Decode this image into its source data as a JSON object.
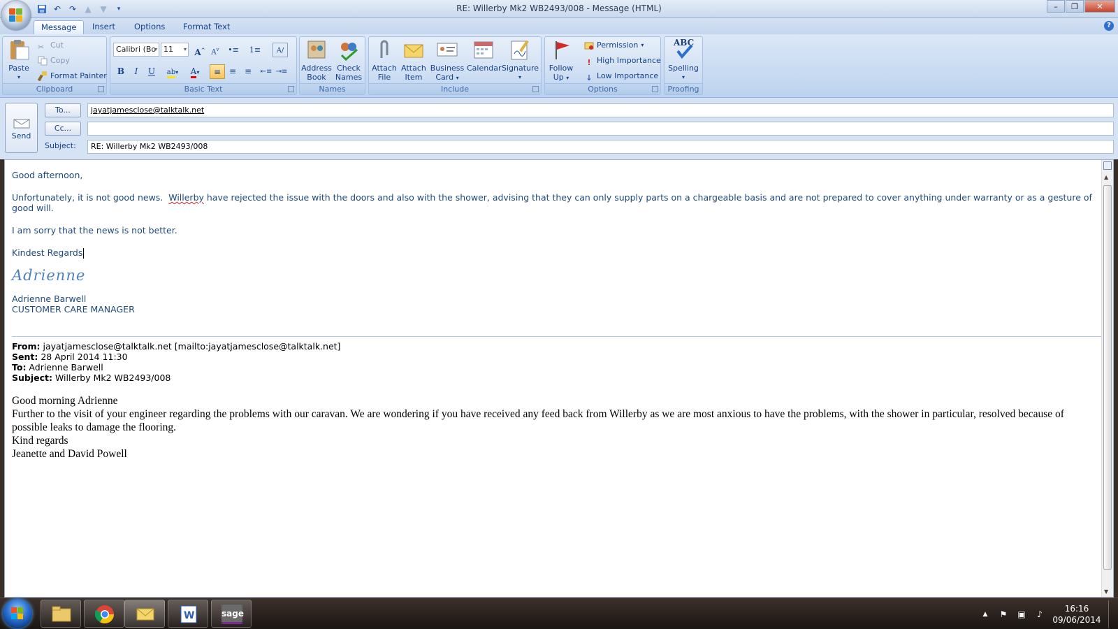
{
  "window": {
    "title": "RE: Willerby Mk2 WB2493/008  - Message (HTML)"
  },
  "tabs": [
    "Message",
    "Insert",
    "Options",
    "Format Text"
  ],
  "ribbon": {
    "clipboard": {
      "label": "Clipboard",
      "paste": "Paste",
      "cut": "Cut",
      "copy": "Copy",
      "format_painter": "Format Painter"
    },
    "basic_text": {
      "label": "Basic Text",
      "font_name": "Calibri (Bo",
      "font_size": "11",
      "bold": "B",
      "italic": "I",
      "underline": "U"
    },
    "names": {
      "label": "Names",
      "address_book": [
        "Address",
        "Book"
      ],
      "check_names": [
        "Check",
        "Names"
      ]
    },
    "include": {
      "label": "Include",
      "attach_file": [
        "Attach",
        "File"
      ],
      "attach_item": [
        "Attach",
        "Item"
      ],
      "business_card": [
        "Business",
        "Card"
      ],
      "calendar": "Calendar",
      "signature": "Signature"
    },
    "options": {
      "label": "Options",
      "follow_up": [
        "Follow",
        "Up"
      ],
      "permission": "Permission",
      "high_importance": "High Importance",
      "low_importance": "Low Importance"
    },
    "proofing": {
      "label": "Proofing",
      "spelling": "Spelling",
      "abc": "ABC"
    }
  },
  "header": {
    "send": "Send",
    "to_button": "To...",
    "cc_button": "Cc...",
    "subject_label": "Subject:",
    "to_value": "jayatjamesclose@talktalk.net",
    "cc_value": "",
    "subject_value": "RE: Willerby Mk2 WB2493/008"
  },
  "body": {
    "greeting": "Good afternoon,",
    "para1_pre": "Unfortunately, it is not good news.  ",
    "para1_word": "Willerby",
    "para1_post": " have rejected the issue with the doors and also with the shower, advising that they can only supply parts on a chargeable basis and are not prepared to cover anything under warranty or as a gesture of good will.",
    "para2": "I am sorry that the news is not better.",
    "closing": "Kindest Regards",
    "signature_script": "Adrienne",
    "sig_name": "Adrienne Barwell",
    "sig_title": "CUSTOMER CARE MANAGER",
    "orig": {
      "from_label": "From:",
      "from_value": " jayatjamesclose@talktalk.net [mailto:jayatjamesclose@talktalk.net]",
      "sent_label": "Sent:",
      "sent_value": " 28 April 2014 11:30",
      "to_label": "To:",
      "to_value": " Adrienne Barwell",
      "subject_label": "Subject:",
      "subject_value": " Willerby Mk2 WB2493/008",
      "line1": "Good morning Adrienne",
      "line2": "Further to the visit of your engineer regarding the problems with our caravan.  We are wondering if you have received any feed back from Willerby as we are most anxious to have the problems, with the shower in particular, resolved because of possible leaks to damage the flooring.",
      "line3": "Kind regards",
      "line4": "Jeanette and David Powell"
    }
  },
  "taskbar": {
    "time": "16:16",
    "date": "09/06/2014",
    "sage_label": "sage"
  }
}
